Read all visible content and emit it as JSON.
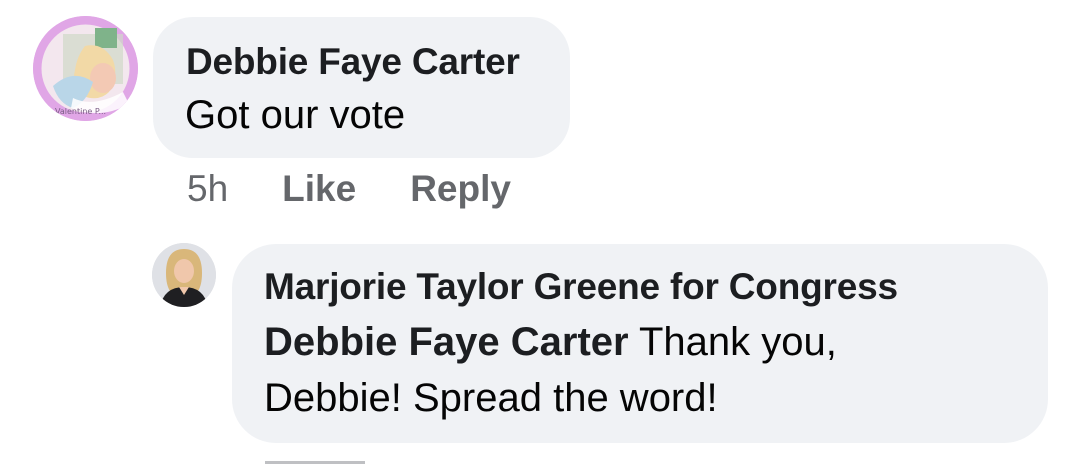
{
  "comment": {
    "author": "Debbie Faye Carter",
    "text": "Got our vote",
    "avatar_caption": "Valentine P...",
    "time": "5h",
    "like_label": "Like",
    "reply_label": "Reply"
  },
  "reply": {
    "author": "Marjorie Taylor Greene for Congress",
    "mention": "Debbie Faye Carter",
    "text_line1": " Thank you,",
    "text_line2": "Debbie! Spread the word!"
  },
  "colors": {
    "bubble": "#f0f2f5",
    "meta_text": "#65676b",
    "avatar_ring": "#e0a6e6"
  }
}
